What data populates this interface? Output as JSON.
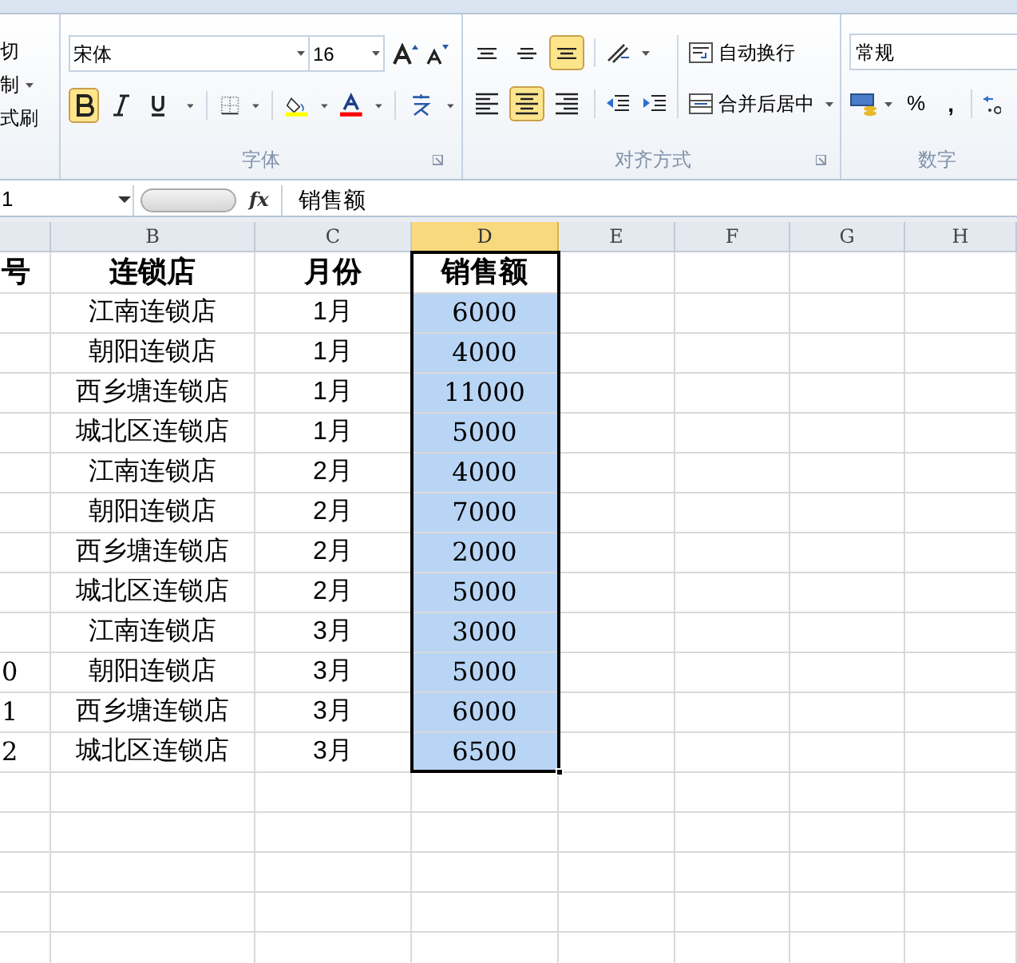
{
  "ribbon": {
    "clipboard": {
      "items": [
        {
          "label": "切"
        },
        {
          "label": "制"
        },
        {
          "label": "式刷"
        }
      ]
    },
    "font": {
      "font_name": "宋体",
      "font_size": "16",
      "buttons": [
        {
          "kind": "bold",
          "selected": true
        },
        {
          "kind": "italic",
          "selected": false
        },
        {
          "kind": "underline",
          "selected": false
        }
      ],
      "label": "字体"
    },
    "alignment": {
      "vertical": [
        {
          "kind": "top",
          "selected": false
        },
        {
          "kind": "middle",
          "selected": false
        },
        {
          "kind": "bottom",
          "selected": true
        }
      ],
      "horizontal": [
        {
          "kind": "left",
          "selected": false
        },
        {
          "kind": "center",
          "selected": true
        },
        {
          "kind": "right",
          "selected": false
        }
      ],
      "wrap_text": "自动换行",
      "merge_center": "合并后居中",
      "label": "对齐方式"
    },
    "number": {
      "format": "常规",
      "percent": "%",
      "comma": ",",
      "label": "数字"
    }
  },
  "formula_bar": {
    "name_box": "1",
    "fx": "fx",
    "formula": "销售额"
  },
  "columns": [
    {
      "label": "B",
      "selected": false
    },
    {
      "label": "C",
      "selected": false
    },
    {
      "label": "D",
      "selected": true
    },
    {
      "label": "E",
      "selected": false
    },
    {
      "label": "F",
      "selected": false
    },
    {
      "label": "G",
      "selected": false
    },
    {
      "label": "H",
      "selected": false
    }
  ],
  "header": {
    "column_a": "号",
    "store": "连锁店",
    "month": "月份",
    "sales": "销售额",
    "active": true
  },
  "rows": [
    {
      "store": "江南连锁店",
      "month": "1月",
      "sales": "6000",
      "selected": true
    },
    {
      "store": "朝阳连锁店",
      "month": "1月",
      "sales": "4000",
      "selected": true
    },
    {
      "store": "西乡塘连锁店",
      "month": "1月",
      "sales": "11000",
      "selected": true
    },
    {
      "store": "城北区连锁店",
      "month": "1月",
      "sales": "5000",
      "selected": true
    },
    {
      "store": "江南连锁店",
      "month": "2月",
      "sales": "4000",
      "selected": true
    },
    {
      "store": "朝阳连锁店",
      "month": "2月",
      "sales": "7000",
      "selected": true
    },
    {
      "store": "西乡塘连锁店",
      "month": "2月",
      "sales": "2000",
      "selected": true
    },
    {
      "store": "城北区连锁店",
      "month": "2月",
      "sales": "5000",
      "selected": true
    },
    {
      "store": "江南连锁店",
      "month": "3月",
      "sales": "3000",
      "selected": true
    },
    {
      "column_a": "0",
      "store": "朝阳连锁店",
      "month": "3月",
      "sales": "5000",
      "selected": true
    },
    {
      "column_a": "1",
      "store": "西乡塘连锁店",
      "month": "3月",
      "sales": "6000",
      "selected": true
    },
    {
      "column_a": "2",
      "store": "城北区连锁店",
      "month": "3月",
      "sales": "6500",
      "selected": true
    }
  ]
}
